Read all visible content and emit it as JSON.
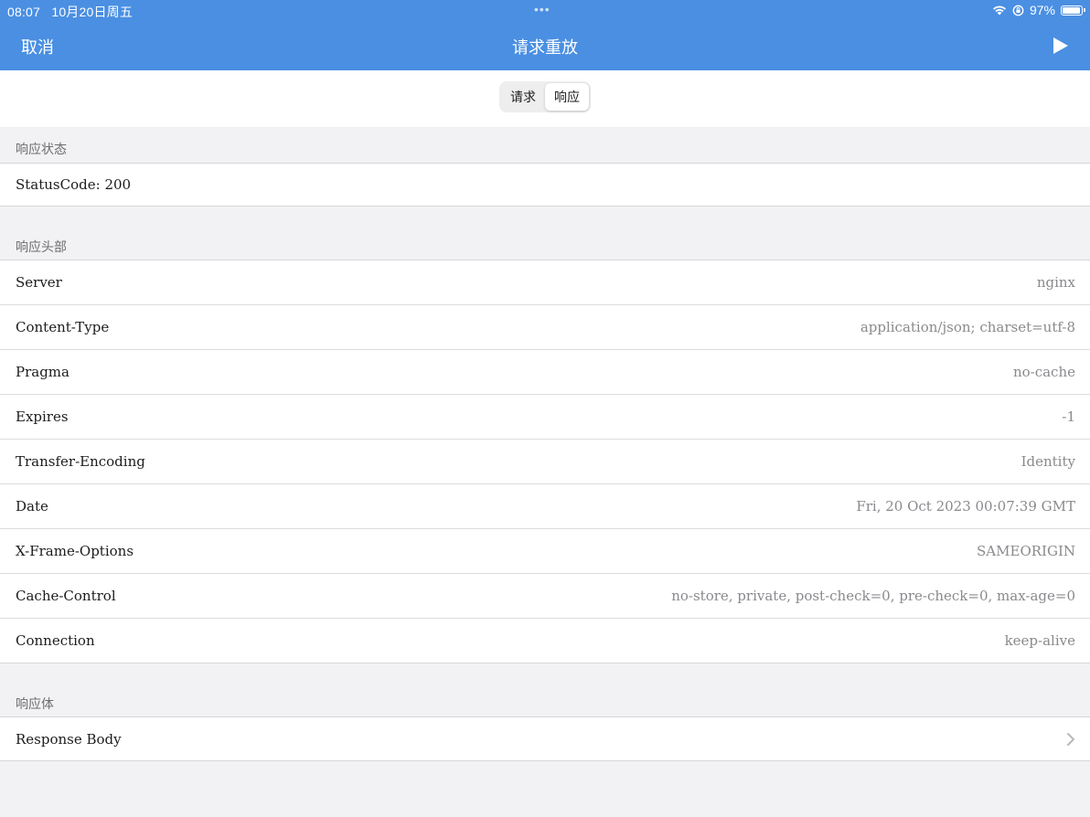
{
  "status_bar": {
    "time": "08:07",
    "date": "10月20日周五",
    "dots": "•••",
    "battery": "97%",
    "battery_level": 0.97
  },
  "nav": {
    "cancel_label": "取消",
    "title": "请求重放",
    "play_icon": "play-icon"
  },
  "segments": {
    "request_label": "请求",
    "response_label": "响应",
    "selected": "响应"
  },
  "status_section": {
    "header": "响应状态",
    "status_code": "StatusCode: 200"
  },
  "headers_section": {
    "header": "响应头部",
    "rows": [
      {
        "key": "Server",
        "value": "nginx"
      },
      {
        "key": "Content-Type",
        "value": "application/json; charset=utf-8"
      },
      {
        "key": "Pragma",
        "value": "no-cache"
      },
      {
        "key": "Expires",
        "value": "-1"
      },
      {
        "key": "Transfer-Encoding",
        "value": "Identity"
      },
      {
        "key": "Date",
        "value": "Fri, 20 Oct 2023 00:07:39 GMT"
      },
      {
        "key": "X-Frame-Options",
        "value": "SAMEORIGIN"
      },
      {
        "key": "Cache-Control",
        "value": "no-store, private, post-check=0, pre-check=0, max-age=0"
      },
      {
        "key": "Connection",
        "value": "keep-alive"
      }
    ]
  },
  "body_section": {
    "header": "响应体",
    "label": "Response Body"
  },
  "colors": {
    "accent": "#4a8fe2",
    "background": "#f2f2f4",
    "secondary_text": "#8a8a8e"
  }
}
